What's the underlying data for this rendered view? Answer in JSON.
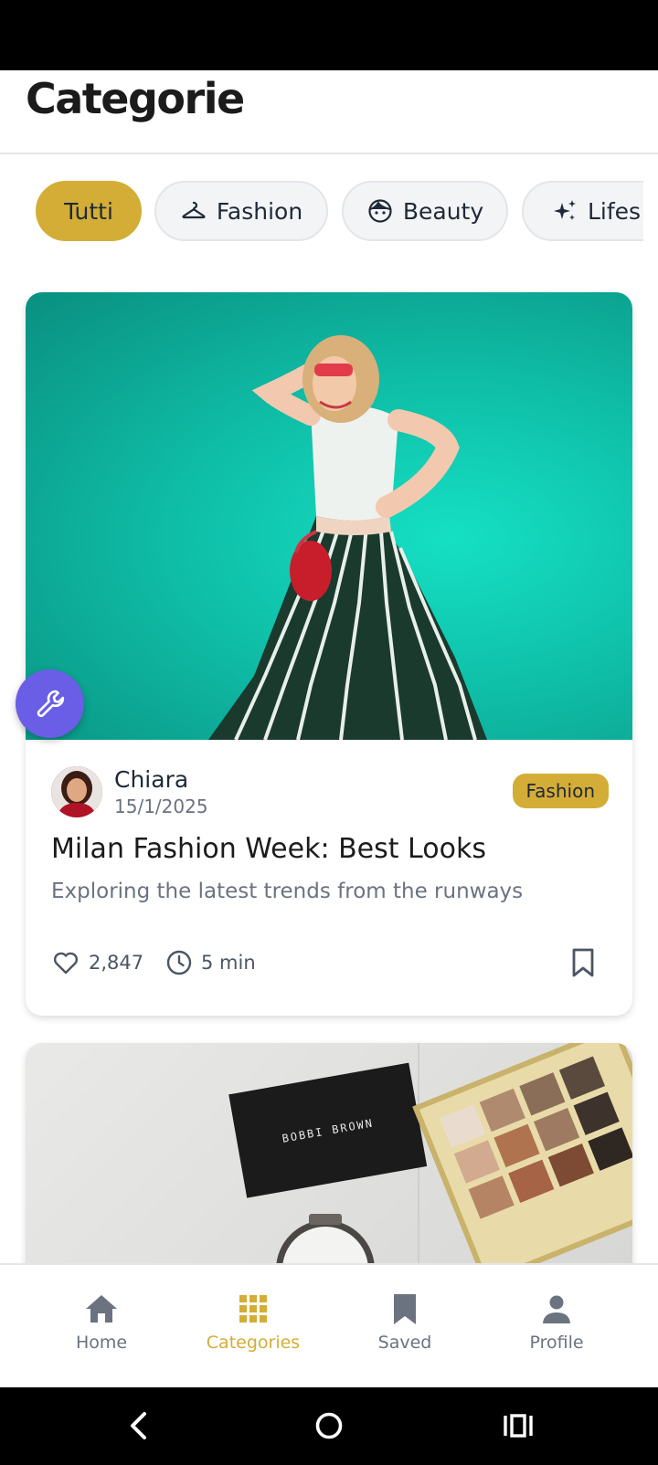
{
  "page": {
    "title": "Categorie"
  },
  "chips": [
    {
      "label": "Tutti",
      "icon": null,
      "active": true
    },
    {
      "label": "Fashion",
      "icon": "hanger-icon",
      "active": false
    },
    {
      "label": "Beauty",
      "icon": "face-icon",
      "active": false
    },
    {
      "label": "Lifes",
      "icon": "sparkles-icon",
      "active": false
    }
  ],
  "posts": [
    {
      "author": "Chiara",
      "date": "15/1/2025",
      "category": "Fashion",
      "title": "Milan Fashion Week: Best Looks",
      "subtitle": "Exploring the latest trends from the runways",
      "likes": "2,847",
      "read_time": "5 min"
    }
  ],
  "image_text": {
    "compact_brand": "BOBBI BROWN"
  },
  "fab": {
    "icon": "wrench-icon"
  },
  "bottom_nav": [
    {
      "label": "Home",
      "icon": "home-icon",
      "active": false
    },
    {
      "label": "Categories",
      "icon": "grid-icon",
      "active": true
    },
    {
      "label": "Saved",
      "icon": "bookmark-icon",
      "active": false
    },
    {
      "label": "Profile",
      "icon": "person-icon",
      "active": false
    }
  ],
  "colors": {
    "accent": "#d4ad37",
    "fab": "#6a5ee6",
    "text_primary": "#1b1b1b",
    "text_secondary": "#6b7280"
  }
}
